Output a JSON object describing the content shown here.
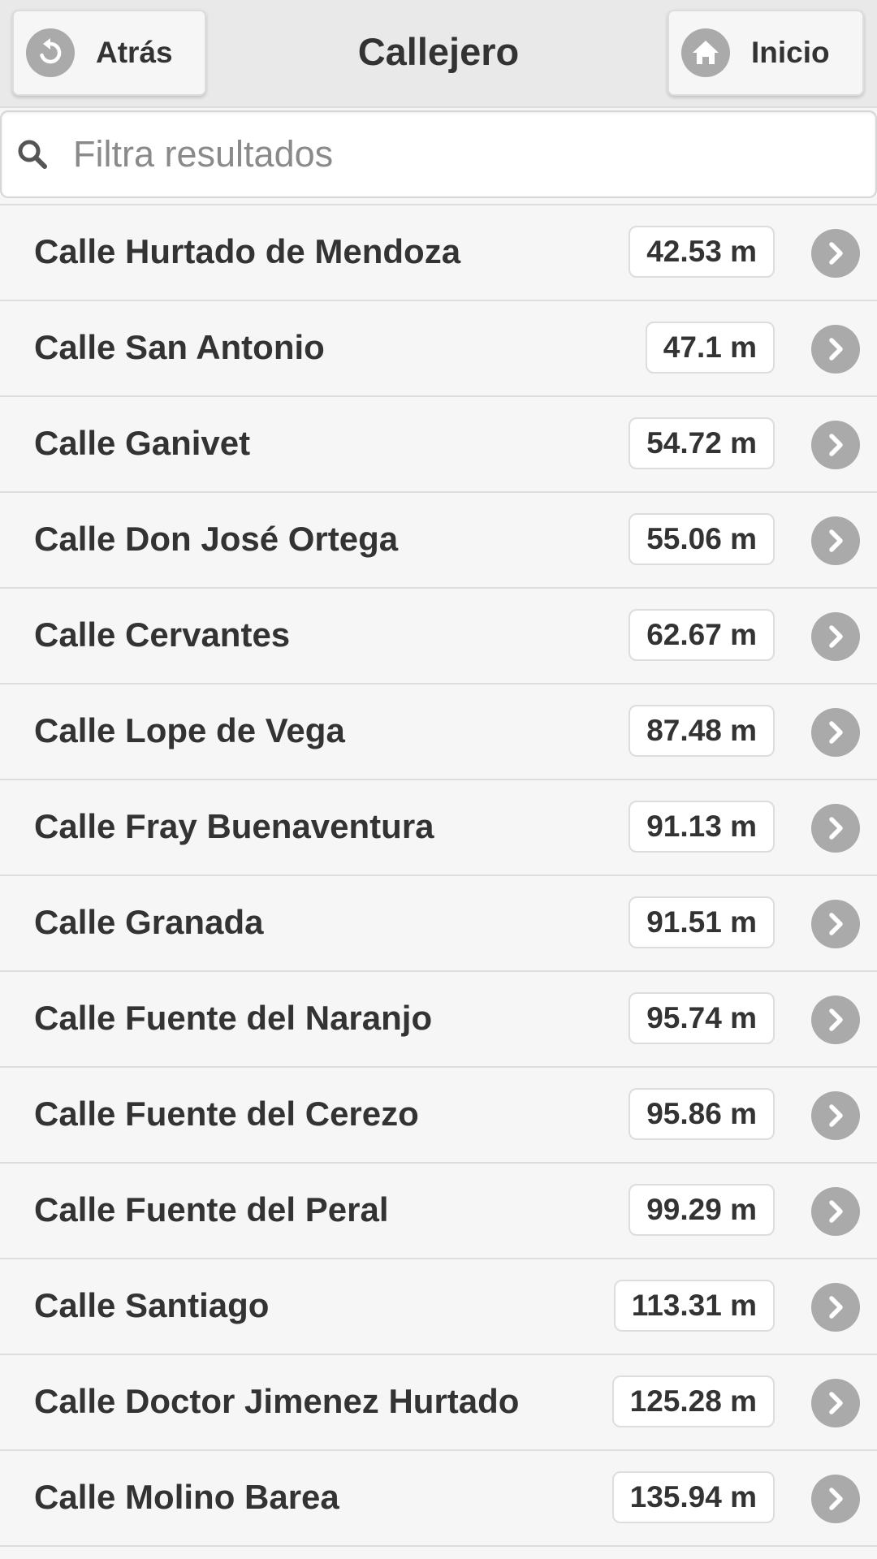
{
  "header": {
    "title": "Callejero",
    "back_label": "Atrás",
    "home_label": "Inicio",
    "icon_color": "#aaaaaa"
  },
  "search": {
    "placeholder": "Filtra resultados",
    "value": ""
  },
  "streets": [
    {
      "name": "Calle Hurtado de Mendoza",
      "distance": "42.53 m"
    },
    {
      "name": "Calle San Antonio",
      "distance": "47.1 m"
    },
    {
      "name": "Calle Ganivet",
      "distance": "54.72 m"
    },
    {
      "name": "Calle Don José Ortega",
      "distance": "55.06 m"
    },
    {
      "name": "Calle Cervantes",
      "distance": "62.67 m"
    },
    {
      "name": "Calle Lope de Vega",
      "distance": "87.48 m"
    },
    {
      "name": "Calle Fray Buenaventura",
      "distance": "91.13 m"
    },
    {
      "name": "Calle Granada",
      "distance": "91.51 m"
    },
    {
      "name": "Calle Fuente del Naranjo",
      "distance": "95.74 m"
    },
    {
      "name": "Calle Fuente del Cerezo",
      "distance": "95.86 m"
    },
    {
      "name": "Calle Fuente del Peral",
      "distance": "99.29 m"
    },
    {
      "name": "Calle Santiago",
      "distance": "113.31 m"
    },
    {
      "name": "Calle Doctor Jimenez Hurtado",
      "distance": "125.28 m"
    },
    {
      "name": "Calle Molino Barea",
      "distance": "135.94 m"
    }
  ]
}
